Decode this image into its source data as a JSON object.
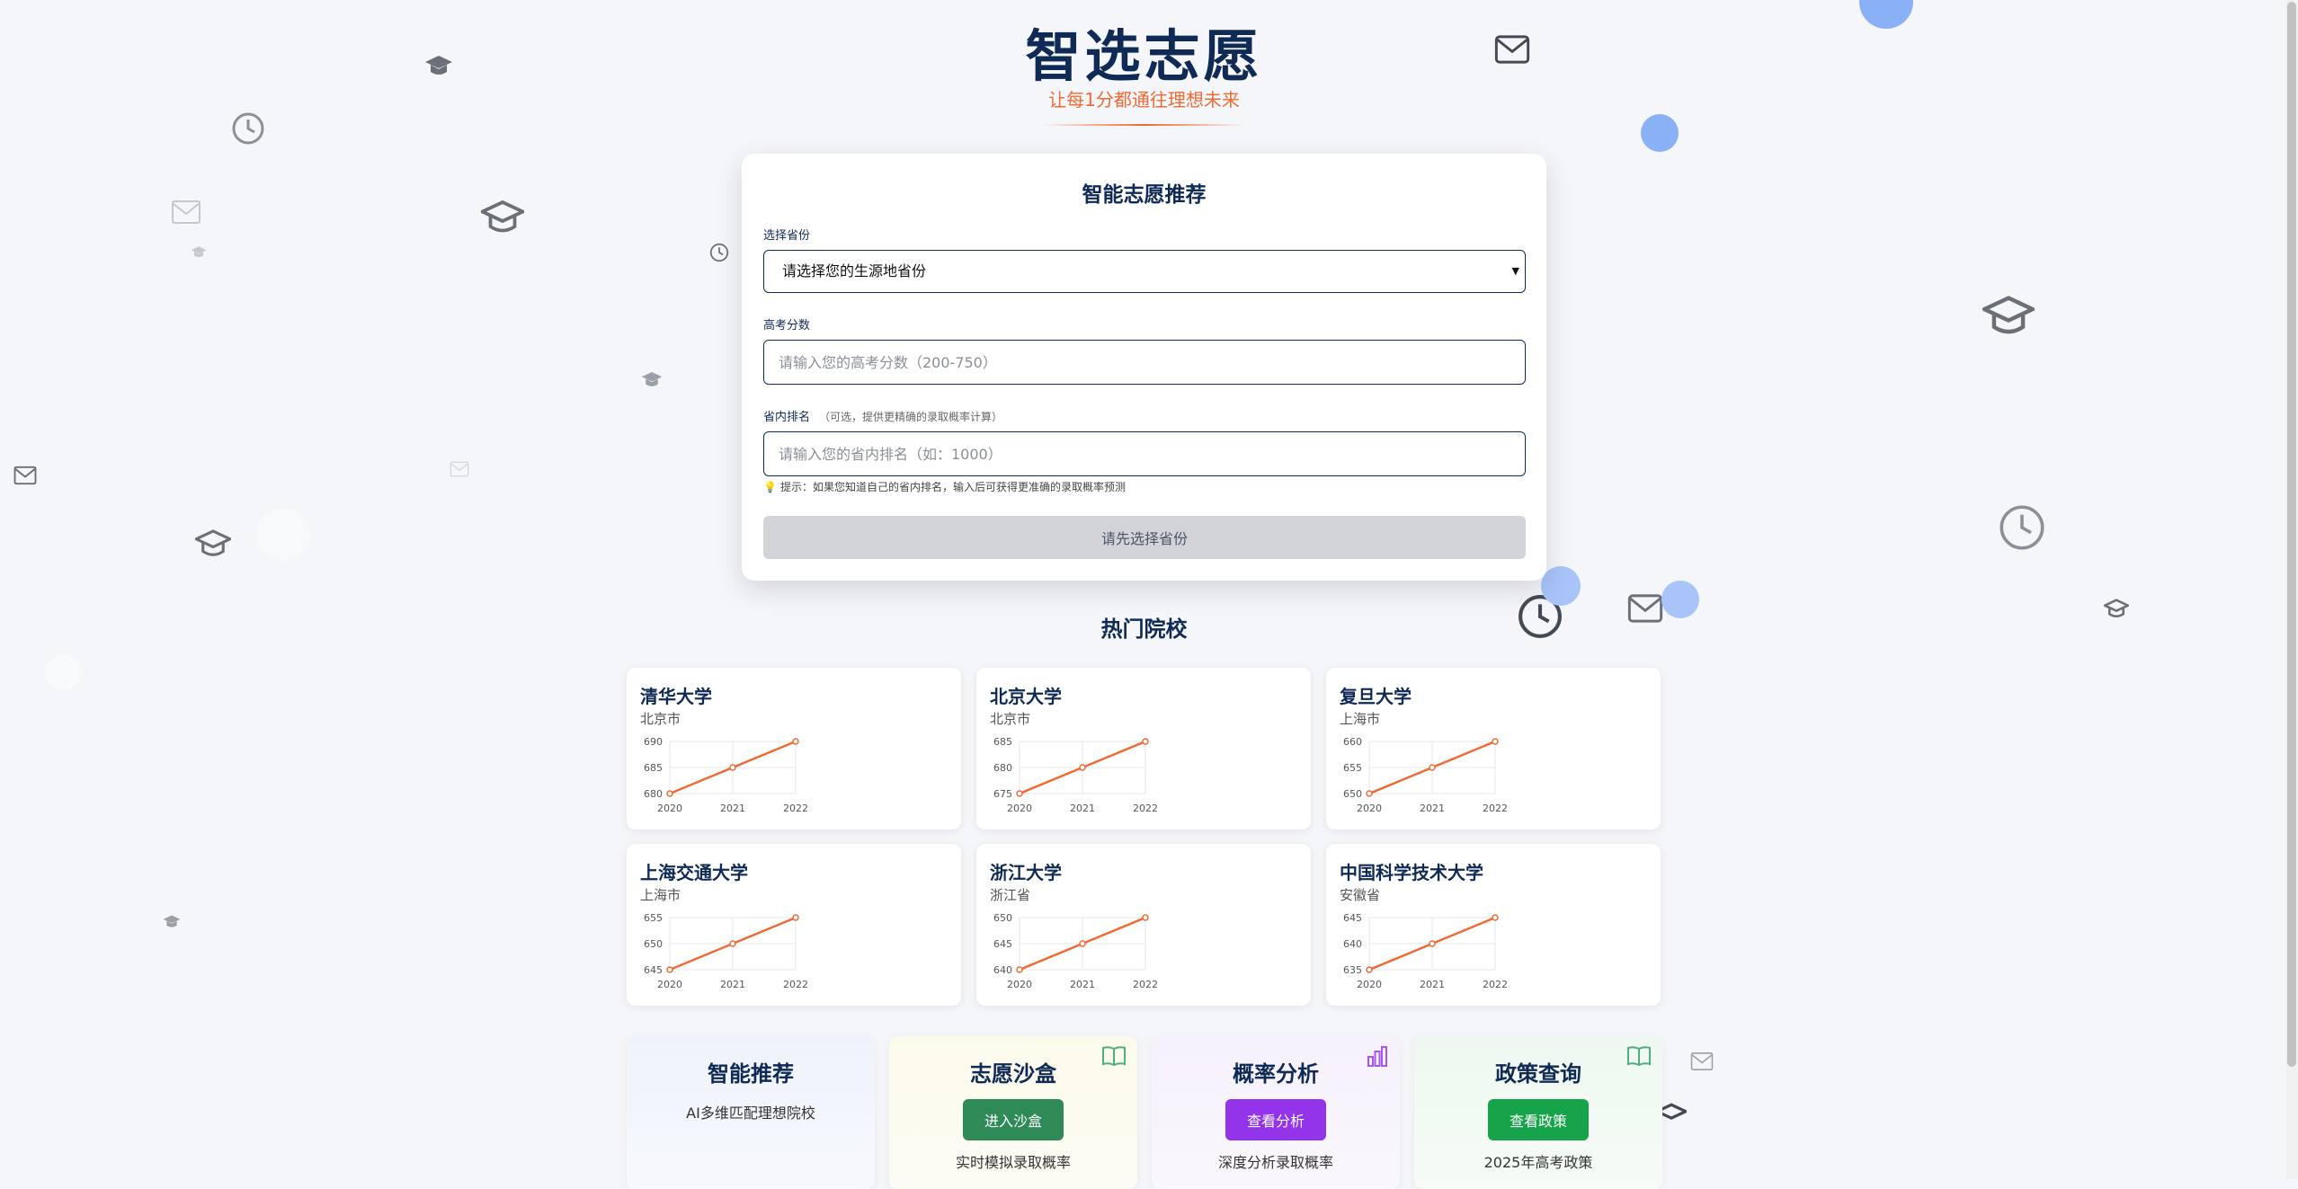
{
  "header": {
    "title": "智选志愿",
    "slogan": "让每1分都通往理想未来"
  },
  "form": {
    "title": "智能志愿推荐",
    "province_label": "选择省份",
    "province_value": "请选择您的生源地省份",
    "score_label": "高考分数",
    "score_placeholder": "请输入您的高考分数（200-750）",
    "rank_label": "省内排名",
    "rank_hint": "（可选，提供更精确的录取概率计算）",
    "rank_placeholder": "请输入您的省内排名（如：1000）",
    "tip": "提示：如果您知道自己的省内排名，输入后可获得更准确的录取概率预测",
    "submit_label": "请先选择省份"
  },
  "hot": {
    "title": "热门院校",
    "universities": [
      {
        "name": "清华大学",
        "location": "北京市",
        "chart_data": {
          "type": "line",
          "x": [
            "2020",
            "2021",
            "2022"
          ],
          "values": [
            680,
            685,
            690
          ],
          "yticks": [
            680,
            685,
            690
          ],
          "ylim": [
            680,
            690
          ]
        }
      },
      {
        "name": "北京大学",
        "location": "北京市",
        "chart_data": {
          "type": "line",
          "x": [
            "2020",
            "2021",
            "2022"
          ],
          "values": [
            675,
            680,
            685
          ],
          "yticks": [
            675,
            680,
            685
          ],
          "ylim": [
            675,
            685
          ]
        }
      },
      {
        "name": "复旦大学",
        "location": "上海市",
        "chart_data": {
          "type": "line",
          "x": [
            "2020",
            "2021",
            "2022"
          ],
          "values": [
            650,
            655,
            660
          ],
          "yticks": [
            650,
            655,
            660
          ],
          "ylim": [
            650,
            660
          ]
        }
      },
      {
        "name": "上海交通大学",
        "location": "上海市",
        "chart_data": {
          "type": "line",
          "x": [
            "2020",
            "2021",
            "2022"
          ],
          "values": [
            645,
            650,
            655
          ],
          "yticks": [
            645,
            650,
            655
          ],
          "ylim": [
            645,
            655
          ]
        }
      },
      {
        "name": "浙江大学",
        "location": "浙江省",
        "chart_data": {
          "type": "line",
          "x": [
            "2020",
            "2021",
            "2022"
          ],
          "values": [
            640,
            645,
            650
          ],
          "yticks": [
            640,
            645,
            650
          ],
          "ylim": [
            640,
            650
          ]
        }
      },
      {
        "name": "中国科学技术大学",
        "location": "安徽省",
        "chart_data": {
          "type": "line",
          "x": [
            "2020",
            "2021",
            "2022"
          ],
          "values": [
            635,
            640,
            645
          ],
          "yticks": [
            635,
            640,
            645
          ],
          "ylim": [
            635,
            645
          ]
        }
      }
    ]
  },
  "features": [
    {
      "title": "智能推荐",
      "desc": "AI多维匹配理想院校",
      "button": "",
      "icon": "none"
    },
    {
      "title": "志愿沙盒",
      "desc": "实时模拟录取概率",
      "button": "进入沙盒",
      "icon": "book-icon"
    },
    {
      "title": "概率分析",
      "desc": "深度分析录取概率",
      "button": "查看分析",
      "icon": "bar-chart-icon"
    },
    {
      "title": "政策查询",
      "desc": "2025年高考政策",
      "button": "查看政策",
      "icon": "book-icon"
    }
  ],
  "colors": {
    "primary": "#0f2a55",
    "accent": "#f06a34",
    "sandbox_button": "#2e8b57",
    "analysis_button": "#9333ea",
    "policy_button": "#16a34a"
  }
}
